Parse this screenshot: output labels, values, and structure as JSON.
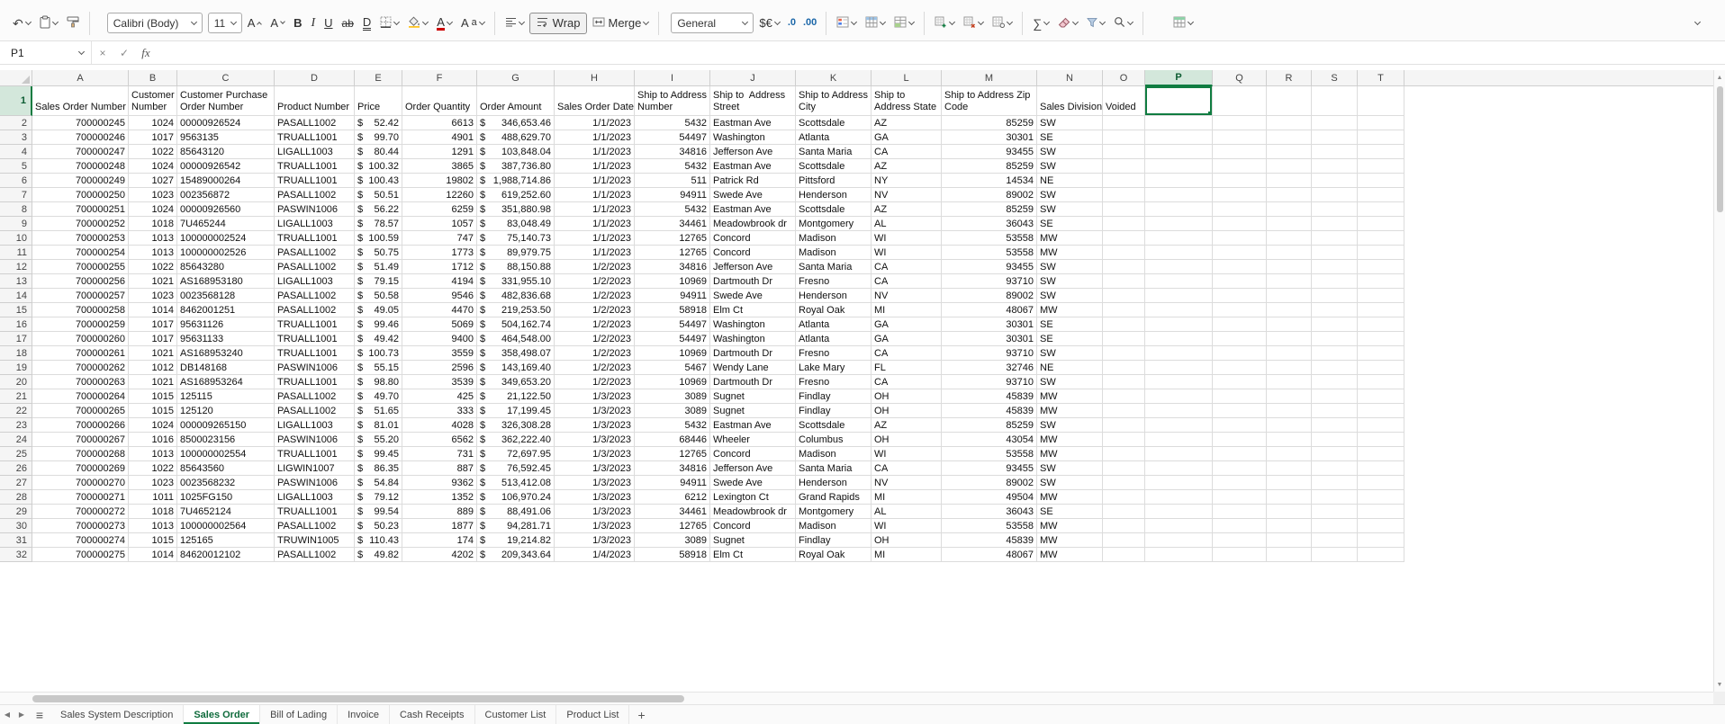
{
  "icons": {
    "undo": "↶",
    "sum": "∑",
    "cancel": "×",
    "enter": "✓",
    "fx": "fx",
    "hamburger": "≡",
    "tab_prev": "◀",
    "tab_next": "▶",
    "scroll_up": "▲",
    "scroll_down": "▼"
  },
  "ribbon": {
    "font_name": "Calibri (Body)",
    "font_size": "11",
    "grow_font": "A",
    "shrink_font": "A",
    "bold": "B",
    "italic": "I",
    "underline": "U",
    "strikethrough": "ab",
    "double_underline": "D",
    "font_color": "A",
    "supsub_main": "A",
    "supsub_small": "a",
    "wrap": "Wrap",
    "merge": "Merge",
    "number_format": "General",
    "currency": "$€",
    "dec_decimal": ".0",
    "inc_decimal": ".00"
  },
  "formula_bar": {
    "name_box": "P1",
    "formula": ""
  },
  "grid": {
    "column_letters": [
      "A",
      "B",
      "C",
      "D",
      "E",
      "F",
      "G",
      "H",
      "I",
      "J",
      "K",
      "L",
      "M",
      "N",
      "O",
      "P",
      "Q",
      "R",
      "S",
      "T"
    ],
    "selected_column": "P",
    "selected_row": 1,
    "selected_cell": "P1",
    "currency_symbol": "$",
    "accent_green": "#107c41",
    "headers": [
      [
        "Sales Order Number"
      ],
      [
        "Customer",
        "Number"
      ],
      [
        "Customer Purchase",
        "Order Number"
      ],
      [
        "Product Number"
      ],
      [
        "Price"
      ],
      [
        "Order Quantity"
      ],
      [
        "Order Amount"
      ],
      [
        "Sales Order Date"
      ],
      [
        "Ship to Address",
        "Number"
      ],
      [
        "Ship to  Address",
        "Street"
      ],
      [
        "Ship to Address",
        "City"
      ],
      [
        "Ship to",
        "Address State"
      ],
      [
        "Ship to Address Zip",
        "Code"
      ],
      [
        "Sales Division"
      ],
      [
        "Voided"
      ]
    ],
    "rows": [
      [
        "700000245",
        "1024",
        "00000926524",
        "PASALL1002",
        "52.42",
        "6613",
        "346,653.46",
        "1/1/2023",
        "5432",
        "Eastman Ave",
        "Scottsdale",
        "AZ",
        "85259",
        "SW",
        ""
      ],
      [
        "700000246",
        "1017",
        "9563135",
        "TRUALL1001",
        "99.70",
        "4901",
        "488,629.70",
        "1/1/2023",
        "54497",
        "Washington",
        "Atlanta",
        "GA",
        "30301",
        "SE",
        ""
      ],
      [
        "700000247",
        "1022",
        "85643120",
        "LIGALL1003",
        "80.44",
        "1291",
        "103,848.04",
        "1/1/2023",
        "34816",
        "Jefferson Ave",
        "Santa Maria",
        "CA",
        "93455",
        "SW",
        ""
      ],
      [
        "700000248",
        "1024",
        "00000926542",
        "TRUALL1001",
        "100.32",
        "3865",
        "387,736.80",
        "1/1/2023",
        "5432",
        "Eastman Ave",
        "Scottsdale",
        "AZ",
        "85259",
        "SW",
        ""
      ],
      [
        "700000249",
        "1027",
        "15489000264",
        "TRUALL1001",
        "100.43",
        "19802",
        "1,988,714.86",
        "1/1/2023",
        "511",
        "Patrick Rd",
        "Pittsford",
        "NY",
        "14534",
        "NE",
        ""
      ],
      [
        "700000250",
        "1023",
        "002356872",
        "PASALL1002",
        "50.51",
        "12260",
        "619,252.60",
        "1/1/2023",
        "94911",
        "Swede Ave",
        "Henderson",
        "NV",
        "89002",
        "SW",
        ""
      ],
      [
        "700000251",
        "1024",
        "00000926560",
        "PASWIN1006",
        "56.22",
        "6259",
        "351,880.98",
        "1/1/2023",
        "5432",
        "Eastman Ave",
        "Scottsdale",
        "AZ",
        "85259",
        "SW",
        ""
      ],
      [
        "700000252",
        "1018",
        "7U465244",
        "LIGALL1003",
        "78.57",
        "1057",
        "83,048.49",
        "1/1/2023",
        "34461",
        "Meadowbrook dr",
        "Montgomery",
        "AL",
        "36043",
        "SE",
        ""
      ],
      [
        "700000253",
        "1013",
        "100000002524",
        "TRUALL1001",
        "100.59",
        "747",
        "75,140.73",
        "1/1/2023",
        "12765",
        "Concord",
        "Madison",
        "WI",
        "53558",
        "MW",
        ""
      ],
      [
        "700000254",
        "1013",
        "100000002526",
        "PASALL1002",
        "50.75",
        "1773",
        "89,979.75",
        "1/1/2023",
        "12765",
        "Concord",
        "Madison",
        "WI",
        "53558",
        "MW",
        ""
      ],
      [
        "700000255",
        "1022",
        "85643280",
        "PASALL1002",
        "51.49",
        "1712",
        "88,150.88",
        "1/2/2023",
        "34816",
        "Jefferson Ave",
        "Santa Maria",
        "CA",
        "93455",
        "SW",
        ""
      ],
      [
        "700000256",
        "1021",
        "AS168953180",
        "LIGALL1003",
        "79.15",
        "4194",
        "331,955.10",
        "1/2/2023",
        "10969",
        "Dartmouth Dr",
        "Fresno",
        "CA",
        "93710",
        "SW",
        ""
      ],
      [
        "700000257",
        "1023",
        "0023568128",
        "PASALL1002",
        "50.58",
        "9546",
        "482,836.68",
        "1/2/2023",
        "94911",
        "Swede Ave",
        "Henderson",
        "NV",
        "89002",
        "SW",
        ""
      ],
      [
        "700000258",
        "1014",
        "8462001251",
        "PASALL1002",
        "49.05",
        "4470",
        "219,253.50",
        "1/2/2023",
        "58918",
        "Elm Ct",
        "Royal Oak",
        "MI",
        "48067",
        "MW",
        ""
      ],
      [
        "700000259",
        "1017",
        "95631126",
        "TRUALL1001",
        "99.46",
        "5069",
        "504,162.74",
        "1/2/2023",
        "54497",
        "Washington",
        "Atlanta",
        "GA",
        "30301",
        "SE",
        ""
      ],
      [
        "700000260",
        "1017",
        "95631133",
        "TRUALL1001",
        "49.42",
        "9400",
        "464,548.00",
        "1/2/2023",
        "54497",
        "Washington",
        "Atlanta",
        "GA",
        "30301",
        "SE",
        ""
      ],
      [
        "700000261",
        "1021",
        "AS168953240",
        "TRUALL1001",
        "100.73",
        "3559",
        "358,498.07",
        "1/2/2023",
        "10969",
        "Dartmouth Dr",
        "Fresno",
        "CA",
        "93710",
        "SW",
        ""
      ],
      [
        "700000262",
        "1012",
        "DB148168",
        "PASWIN1006",
        "55.15",
        "2596",
        "143,169.40",
        "1/2/2023",
        "5467",
        "Wendy Lane",
        "Lake Mary",
        "FL",
        "32746",
        "NE",
        ""
      ],
      [
        "700000263",
        "1021",
        "AS168953264",
        "TRUALL1001",
        "98.80",
        "3539",
        "349,653.20",
        "1/2/2023",
        "10969",
        "Dartmouth Dr",
        "Fresno",
        "CA",
        "93710",
        "SW",
        ""
      ],
      [
        "700000264",
        "1015",
        "125115",
        "PASALL1002",
        "49.70",
        "425",
        "21,122.50",
        "1/3/2023",
        "3089",
        "Sugnet",
        "Findlay",
        "OH",
        "45839",
        "MW",
        ""
      ],
      [
        "700000265",
        "1015",
        "125120",
        "PASALL1002",
        "51.65",
        "333",
        "17,199.45",
        "1/3/2023",
        "3089",
        "Sugnet",
        "Findlay",
        "OH",
        "45839",
        "MW",
        ""
      ],
      [
        "700000266",
        "1024",
        "000009265150",
        "LIGALL1003",
        "81.01",
        "4028",
        "326,308.28",
        "1/3/2023",
        "5432",
        "Eastman Ave",
        "Scottsdale",
        "AZ",
        "85259",
        "SW",
        ""
      ],
      [
        "700000267",
        "1016",
        "8500023156",
        "PASWIN1006",
        "55.20",
        "6562",
        "362,222.40",
        "1/3/2023",
        "68446",
        "Wheeler",
        "Columbus",
        "OH",
        "43054",
        "MW",
        ""
      ],
      [
        "700000268",
        "1013",
        "100000002554",
        "TRUALL1001",
        "99.45",
        "731",
        "72,697.95",
        "1/3/2023",
        "12765",
        "Concord",
        "Madison",
        "WI",
        "53558",
        "MW",
        ""
      ],
      [
        "700000269",
        "1022",
        "85643560",
        "LIGWIN1007",
        "86.35",
        "887",
        "76,592.45",
        "1/3/2023",
        "34816",
        "Jefferson Ave",
        "Santa Maria",
        "CA",
        "93455",
        "SW",
        ""
      ],
      [
        "700000270",
        "1023",
        "0023568232",
        "PASWIN1006",
        "54.84",
        "9362",
        "513,412.08",
        "1/3/2023",
        "94911",
        "Swede Ave",
        "Henderson",
        "NV",
        "89002",
        "SW",
        ""
      ],
      [
        "700000271",
        "1011",
        "1025FG150",
        "LIGALL1003",
        "79.12",
        "1352",
        "106,970.24",
        "1/3/2023",
        "6212",
        "Lexington Ct",
        "Grand Rapids",
        "MI",
        "49504",
        "MW",
        ""
      ],
      [
        "700000272",
        "1018",
        "7U4652124",
        "TRUALL1001",
        "99.54",
        "889",
        "88,491.06",
        "1/3/2023",
        "34461",
        "Meadowbrook dr",
        "Montgomery",
        "AL",
        "36043",
        "SE",
        ""
      ],
      [
        "700000273",
        "1013",
        "100000002564",
        "PASALL1002",
        "50.23",
        "1877",
        "94,281.71",
        "1/3/2023",
        "12765",
        "Concord",
        "Madison",
        "WI",
        "53558",
        "MW",
        ""
      ],
      [
        "700000274",
        "1015",
        "125165",
        "TRUWIN1005",
        "110.43",
        "174",
        "19,214.82",
        "1/3/2023",
        "3089",
        "Sugnet",
        "Findlay",
        "OH",
        "45839",
        "MW",
        ""
      ],
      [
        "700000275",
        "1014",
        "84620012102",
        "PASALL1002",
        "49.82",
        "4202",
        "209,343.64",
        "1/4/2023",
        "58918",
        "Elm Ct",
        "Royal Oak",
        "MI",
        "48067",
        "MW",
        ""
      ]
    ]
  },
  "sheet_tabs": {
    "tabs": [
      "Sales System Description",
      "Sales Order",
      "Bill of Lading",
      "Invoice",
      "Cash Receipts",
      "Customer List",
      "Product List"
    ],
    "active": "Sales Order",
    "add": "+"
  }
}
